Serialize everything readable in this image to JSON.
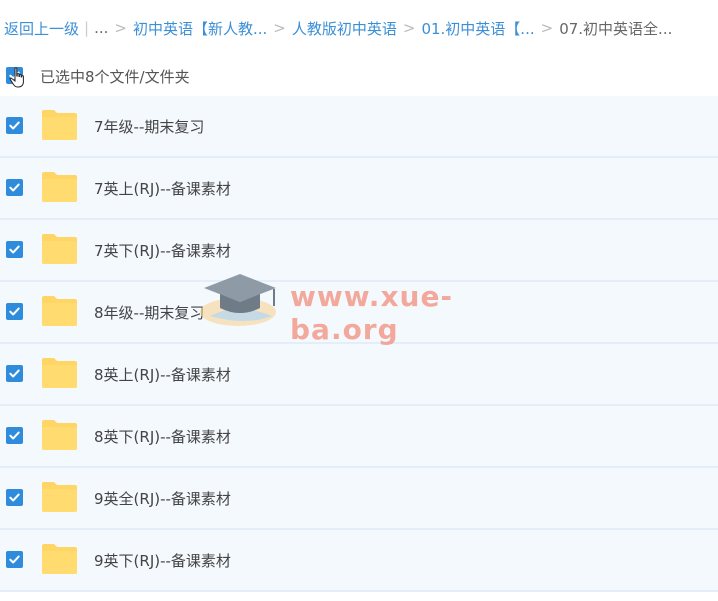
{
  "breadcrumb": {
    "back": "返回上一级",
    "ellipsis": "...",
    "items": [
      "初中英语【新人教...",
      "人教版初中英语",
      "01.初中英语【...",
      "07.初中英语全..."
    ]
  },
  "selection": {
    "label": "已选中8个文件/文件夹",
    "checked": true
  },
  "files": [
    {
      "name": "7年级--期末复习",
      "checked": true
    },
    {
      "name": "7英上(RJ)--备课素材",
      "checked": true
    },
    {
      "name": "7英下(RJ)--备课素材",
      "checked": true
    },
    {
      "name": "8年级--期末复习",
      "checked": true
    },
    {
      "name": "8英上(RJ)--备课素材",
      "checked": true
    },
    {
      "name": "8英下(RJ)--备课素材",
      "checked": true
    },
    {
      "name": "9英全(RJ)--备课素材",
      "checked": true
    },
    {
      "name": "9英下(RJ)--备课素材",
      "checked": true
    }
  ],
  "watermark": {
    "text": "www.xue-ba.org"
  },
  "colors": {
    "accent": "#2f8cdc",
    "link": "#3b8fd6",
    "folder": "#ffd666",
    "row_bg": "#f4f9fe"
  }
}
